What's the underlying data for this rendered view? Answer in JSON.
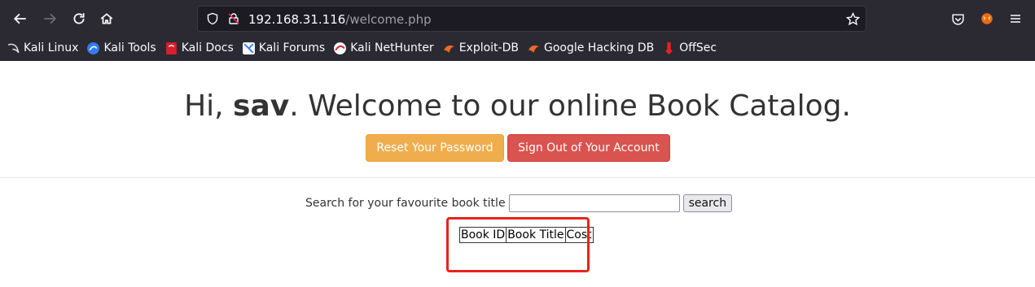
{
  "browser": {
    "url_host": "192.168.31.116",
    "url_path": "/welcome.php",
    "bookmarks": [
      {
        "label": "Kali Linux",
        "icon": "kali-dragon-icon"
      },
      {
        "label": "Kali Tools",
        "icon": "kali-tools-icon"
      },
      {
        "label": "Kali Docs",
        "icon": "kali-docs-icon"
      },
      {
        "label": "Kali Forums",
        "icon": "kali-forums-icon"
      },
      {
        "label": "Kali NetHunter",
        "icon": "kali-nethunter-icon"
      },
      {
        "label": "Exploit-DB",
        "icon": "exploit-db-icon"
      },
      {
        "label": "Google Hacking DB",
        "icon": "ghdb-icon"
      },
      {
        "label": "OffSec",
        "icon": "offsec-icon"
      }
    ]
  },
  "page": {
    "greeting_prefix": "Hi, ",
    "username": "sav",
    "greeting_suffix": ". Welcome to our online Book Catalog.",
    "reset_button": "Reset Your Password",
    "signout_button": "Sign Out of Your Account",
    "search_label": "Search for your favourite book title",
    "search_value": "",
    "search_button": "search",
    "table_headers": [
      "Book ID",
      "Book Title",
      "Cost"
    ]
  },
  "colors": {
    "chrome_bg": "#2b2a33",
    "warning": "#f0ad4e",
    "danger": "#d9534f",
    "highlight": "#e8231e"
  }
}
